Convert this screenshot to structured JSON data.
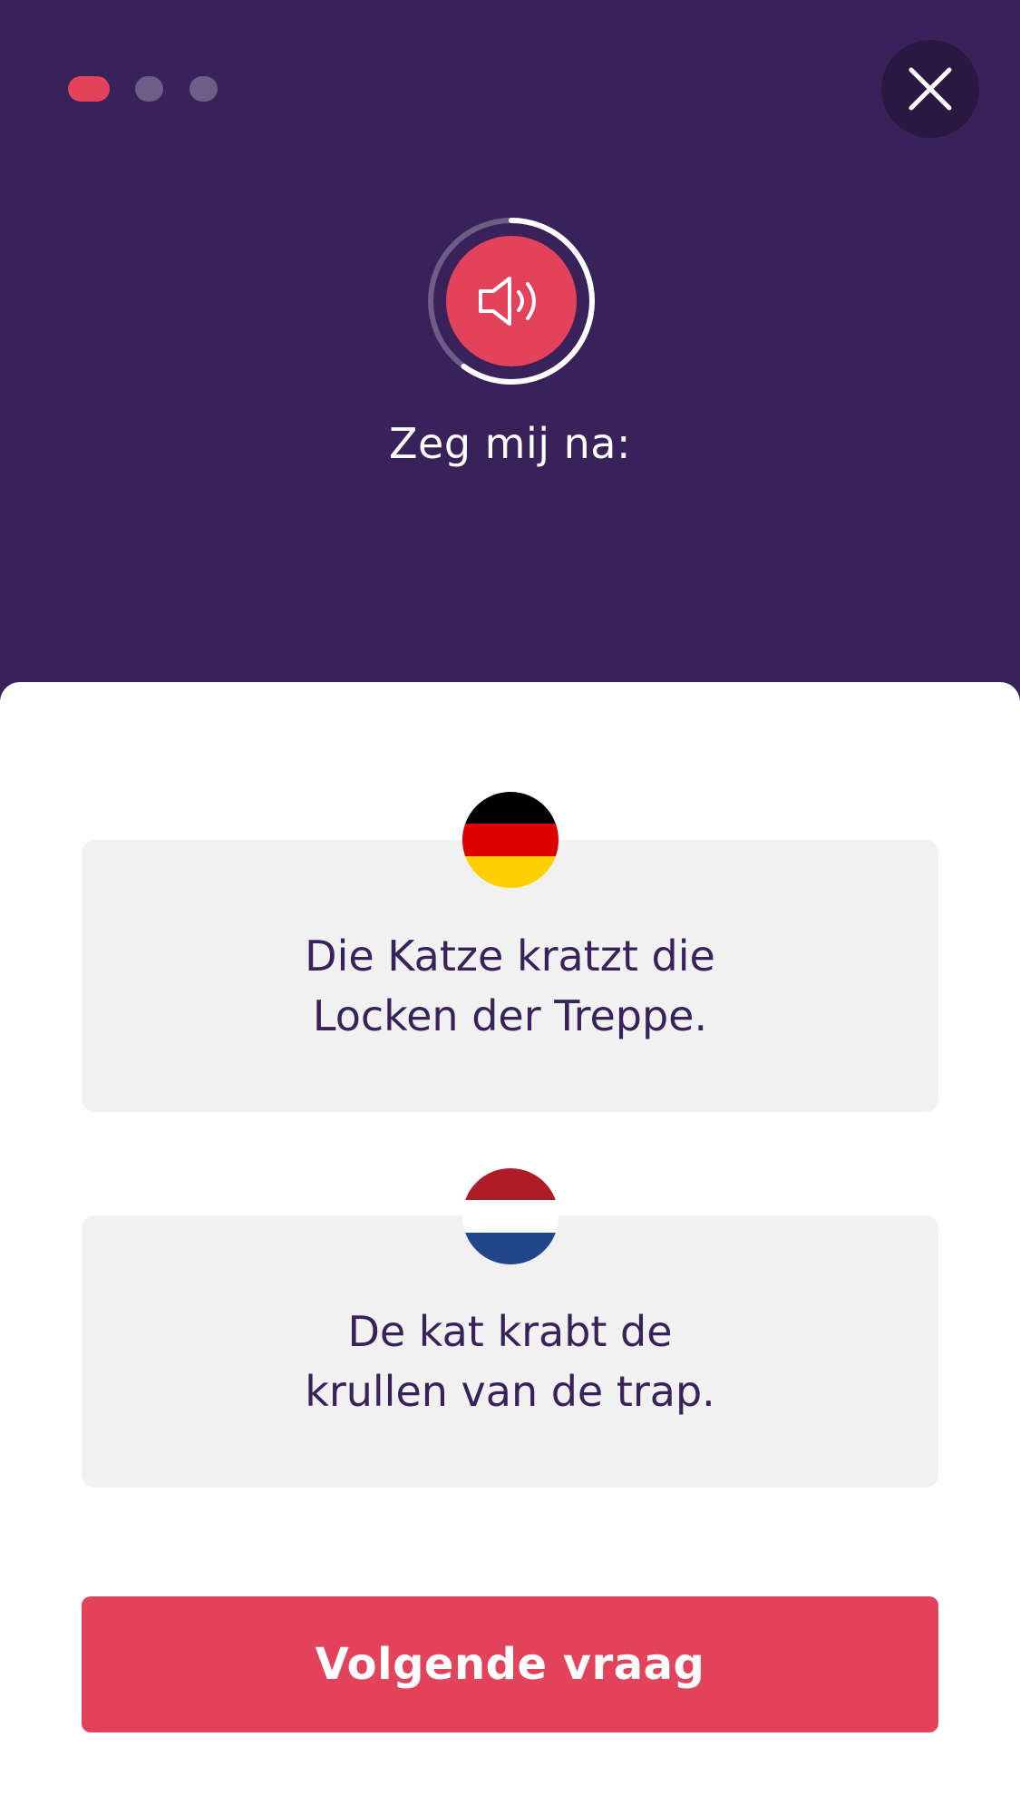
{
  "colors": {
    "header_background": "#382259",
    "accent": "#e2435b",
    "card_background": "#f1f1f2",
    "text_dark": "#382259"
  },
  "progress": {
    "total_steps": 3,
    "current_step": 1
  },
  "header": {
    "close_icon": "close-icon",
    "audio_icon": "speaker-icon",
    "audio_progress_fraction": 0.6,
    "prompt": "Zeg mij na:"
  },
  "cards": {
    "source": {
      "flag_icon": "germany-flag-icon",
      "text": "Die Katze kratzt die\nLocken der Treppe."
    },
    "target": {
      "flag_icon": "netherlands-flag-icon",
      "text": "De kat krabt de\nkrullen van de trap."
    }
  },
  "footer": {
    "next_button_label": "Volgende vraag"
  }
}
